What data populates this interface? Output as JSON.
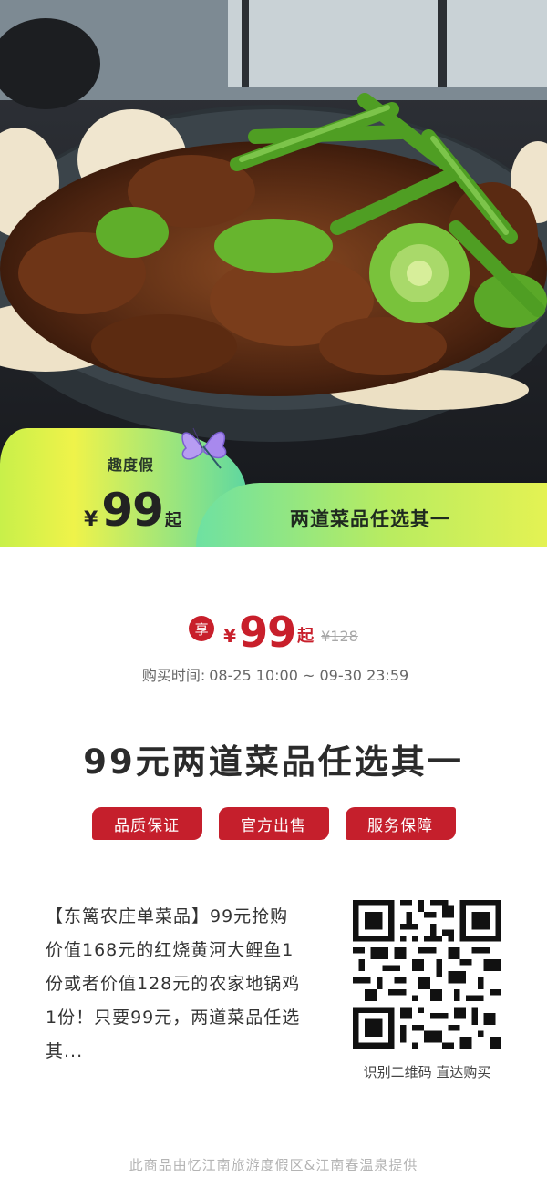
{
  "hero": {
    "brand": "趣度假",
    "price_currency": "¥",
    "price_value": "99",
    "price_suffix": "起",
    "banner_text": "两道菜品任选其一"
  },
  "price": {
    "enjoy_badge": "享",
    "currency": "¥",
    "value": "99",
    "suffix": "起",
    "original": "¥128"
  },
  "purchase_time": {
    "label": "购买时间:",
    "range": "08-25 10:00 ~ 09-30 23:59"
  },
  "title": "99元两道菜品任选其一",
  "badges": [
    "品质保证",
    "官方出售",
    "服务保障"
  ],
  "description": "【东篱农庄单菜品】99元抢购价值168元的红烧黄河大鲤鱼1份或者价值128元的农家地锅鸡1份！只要99元，两道菜品任选其...",
  "qr": {
    "caption": "识别二维码 直达购买"
  },
  "footer": "此商品由忆江南旅游度假区&江南春温泉提供",
  "colors": {
    "accent_red": "#c51f2c",
    "banner_green": "#6ee1a2",
    "banner_yellow": "#eff34a"
  }
}
